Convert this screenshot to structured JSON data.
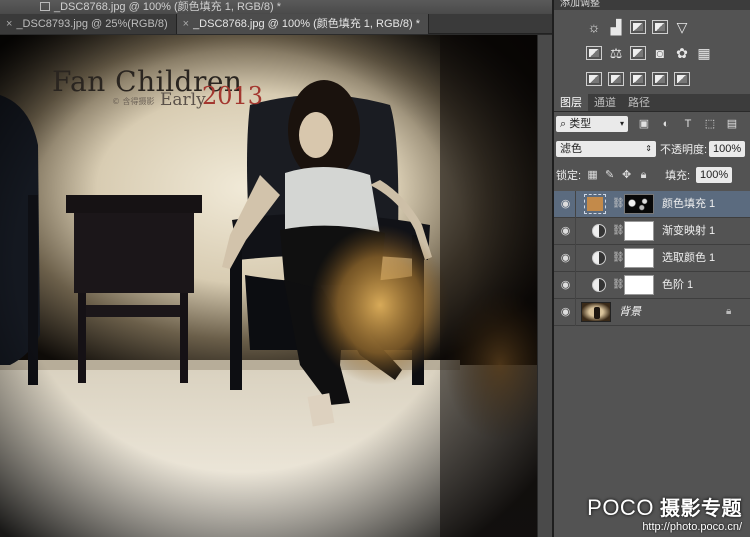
{
  "window": {
    "title": "_DSC8768.jpg @ 100% (颜色填充 1, RGB/8) *"
  },
  "tabs": [
    {
      "label": "_DSC8793.jpg @ 25%(RGB/8)",
      "active": false
    },
    {
      "label": "_DSC8768.jpg @ 100% (颜色填充 1, RGB/8) *",
      "active": true
    }
  ],
  "photo": {
    "title_text": "Fan Children",
    "subtitle_text": "Early",
    "year_text": "2013",
    "credit_text": "© 含得摄影"
  },
  "adjustments_panel": {
    "header": "添加调整",
    "row1_icons": [
      "brightness-icon",
      "levels-icon",
      "curves-icon",
      "exposure-icon",
      "vibrance-icon"
    ],
    "row2_icons": [
      "hue-saturation-icon",
      "color-balance-icon",
      "black-white-icon",
      "photo-filter-icon",
      "channel-mixer-icon",
      "color-lookup-icon"
    ],
    "row3_icons": [
      "invert-icon",
      "posterize-icon",
      "threshold-icon",
      "gradient-map-icon",
      "selective-color-icon"
    ]
  },
  "layers_panel": {
    "tabs": [
      {
        "label": "图层",
        "active": true
      },
      {
        "label": "通道",
        "active": false
      },
      {
        "label": "路径",
        "active": false
      }
    ],
    "filter_kind": "类型",
    "blend_mode": "滤色",
    "opacity_label": "不透明度:",
    "opacity_value": "100%",
    "lock_label": "锁定:",
    "fill_label": "填充:",
    "fill_value": "100%",
    "layers": [
      {
        "name": "颜色填充 1",
        "type": "fill",
        "swatch_color": "#c38a4a",
        "selected": true
      },
      {
        "name": "渐变映射 1",
        "type": "adjustment",
        "selected": false
      },
      {
        "name": "选取颜色 1",
        "type": "adjustment",
        "selected": false
      },
      {
        "name": "色阶 1",
        "type": "adjustment",
        "selected": false
      },
      {
        "name": "背景",
        "type": "background",
        "selected": false,
        "locked": true
      }
    ]
  },
  "watermark": {
    "brand": "POCO",
    "brand_suffix": "摄影专题",
    "url": "http://photo.poco.cn/"
  },
  "colors": {
    "panel_bg": "#535353",
    "selected_layer": "#5b6b7f",
    "fill_swatch": "#c38a4a",
    "title_red": "#a3372f"
  }
}
